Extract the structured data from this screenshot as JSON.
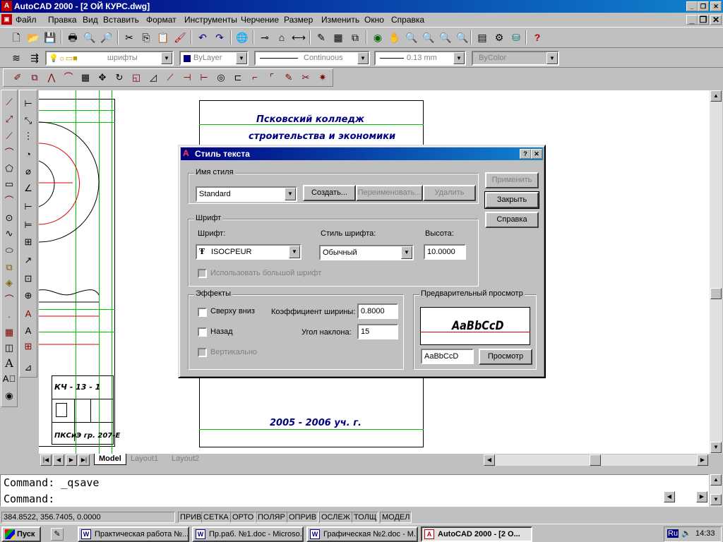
{
  "window": {
    "title": "AutoCAD 2000 - [2 ОЙ КУРС.dwg]"
  },
  "menu": [
    "Файл",
    "Правка",
    "Вид",
    "Вставить",
    "Формат",
    "Инструменты",
    "Черчение",
    "Размер",
    "Изменить",
    "Окно",
    "Справка"
  ],
  "layers_toolbar": {
    "layer_value": "шрифты",
    "color_value": "ByLayer",
    "linetype_value": "Continuous",
    "lineweight_value": "0.13 mm",
    "plotstyle_value": "ByColor"
  },
  "drawing": {
    "college_line1": "Псковский колледж",
    "college_line2": "строительства и экономики",
    "year_text": "2005 - 2006 уч. г.",
    "stamp_code": "КЧ - 13 - 1",
    "stamp_group": "ПКСиЭ гр. 207-Е"
  },
  "dialog": {
    "title": "Стиль текста",
    "style_group": "Имя стиля",
    "style_value": "Standard",
    "create_button": "Создать...",
    "rename_button": "Переименовать...",
    "delete_button": "Удалить",
    "apply_button": "Применить",
    "close_button": "Закрыть",
    "help_button": "Справка",
    "font_group": "Шрифт",
    "font_label": "Шрифт:",
    "font_value": "ISOCPEUR",
    "font_style_label": "Стиль шрифта:",
    "font_style_value": "Обычный",
    "height_label": "Высота:",
    "height_value": "10.0000",
    "bigfont_label": "Использовать большой шрифт",
    "effects_group": "Эффекты",
    "upside_down_label": "Сверху вниз",
    "backwards_label": "Назад",
    "vertical_label": "Вертикально",
    "width_factor_label": "Коэффициент ширины:",
    "width_factor_value": "0.8000",
    "oblique_label": "Угол наклона:",
    "oblique_value": "15",
    "preview_group": "Предварительный просмотр",
    "preview_text": "AaBbCcD",
    "preview_input": "AaBbCcD",
    "preview_button": "Просмотр"
  },
  "layout_tabs": [
    "Model",
    "Layout1",
    "Layout2"
  ],
  "command_lines": [
    "Command: _qsave",
    "Command:"
  ],
  "status": {
    "coords": "384.8522, 356.7405, 0.0000",
    "buttons": [
      "ПРИВ",
      "СЕТКА",
      "ОРТО",
      "ПОЛЯР",
      "ОПРИВ",
      "ОСЛЕЖ",
      "ТОЛЩ",
      "МОДЕЛ"
    ]
  },
  "taskbar": {
    "start": "Пуск",
    "tasks": [
      "Практическая работа №...",
      "Пр.раб. №1.doc - Microso...",
      "Графическая №2.doc - M...",
      "AutoCAD 2000 - [2 О..."
    ],
    "lang": "Ru",
    "clock": "14:33"
  },
  "colors": {
    "title_gradient_start": "#000080",
    "title_gradient_end": "#1084d0",
    "grid_green": "#00c000",
    "text_navy": "#000080",
    "preview_red": "#e00000"
  }
}
